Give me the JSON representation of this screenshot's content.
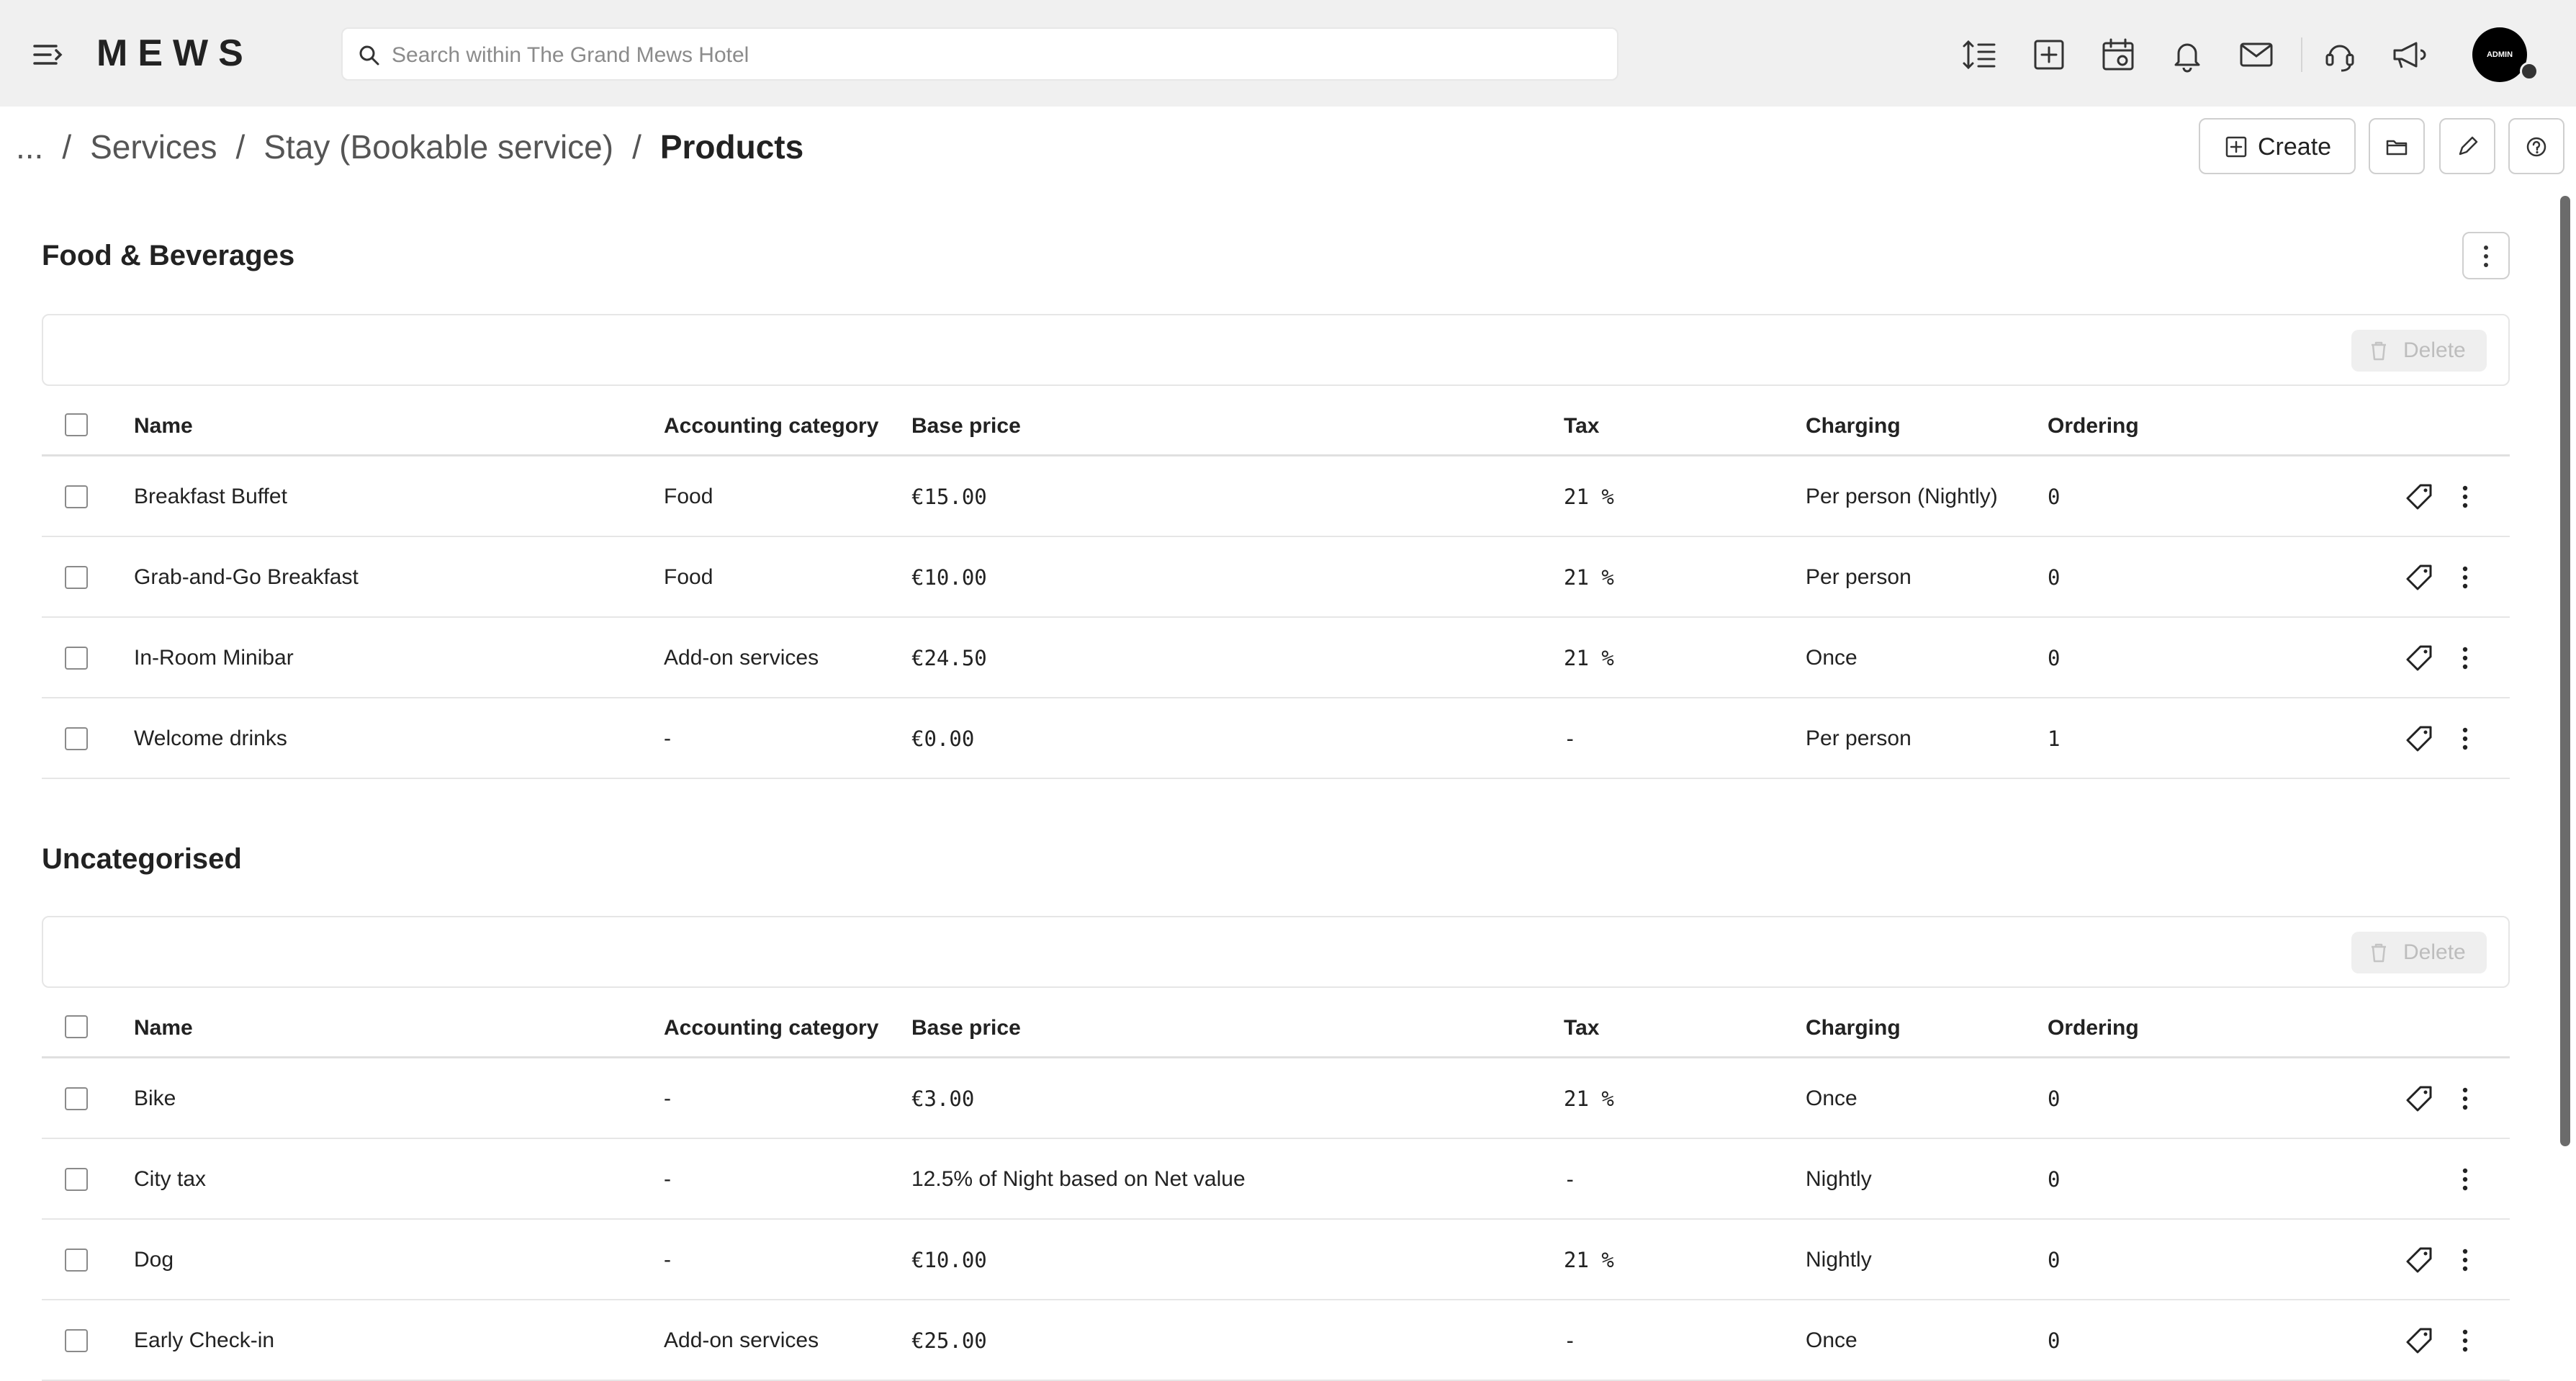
{
  "topbar": {
    "logo": "MEWS",
    "search_placeholder": "Search within The Grand Mews Hotel",
    "avatar_label": "ADMIN"
  },
  "breadcrumb": {
    "ellipsis": "...",
    "items": [
      "Services",
      "Stay (Bookable service)"
    ],
    "current": "Products",
    "separator": "/"
  },
  "actions": {
    "create_label": "Create"
  },
  "sections": [
    {
      "title": "Food & Beverages",
      "delete_label": "Delete",
      "columns": [
        "Name",
        "Accounting category",
        "Base price",
        "Tax",
        "Charging",
        "Ordering"
      ],
      "rows": [
        {
          "name": "Breakfast Buffet",
          "accounting": "Food",
          "base_price": "€15.00",
          "tax": "21 %",
          "charging": "Per person (Nightly)",
          "ordering": "0"
        },
        {
          "name": "Grab-and-Go Breakfast",
          "accounting": "Food",
          "base_price": "€10.00",
          "tax": "21 %",
          "charging": "Per person",
          "ordering": "0"
        },
        {
          "name": "In-Room Minibar",
          "accounting": "Add-on services",
          "base_price": "€24.50",
          "tax": "21 %",
          "charging": "Once",
          "ordering": "0"
        },
        {
          "name": "Welcome drinks",
          "accounting": "-",
          "base_price": "€0.00",
          "tax": "-",
          "charging": "Per person",
          "ordering": "1"
        }
      ]
    },
    {
      "title": "Uncategorised",
      "delete_label": "Delete",
      "columns": [
        "Name",
        "Accounting category",
        "Base price",
        "Tax",
        "Charging",
        "Ordering"
      ],
      "rows": [
        {
          "name": "Bike",
          "accounting": "-",
          "base_price": "€3.00",
          "tax": "21 %",
          "charging": "Once",
          "ordering": "0"
        },
        {
          "name": "City tax",
          "accounting": "-",
          "base_price": "12.5% of Night based on Net value",
          "tax": "-",
          "charging": "Nightly",
          "ordering": "0"
        },
        {
          "name": "Dog",
          "accounting": "-",
          "base_price": "€10.00",
          "tax": "21 %",
          "charging": "Nightly",
          "ordering": "0"
        },
        {
          "name": "Early Check-in",
          "accounting": "Add-on services",
          "base_price": "€25.00",
          "tax": "-",
          "charging": "Once",
          "ordering": "0"
        }
      ]
    }
  ]
}
